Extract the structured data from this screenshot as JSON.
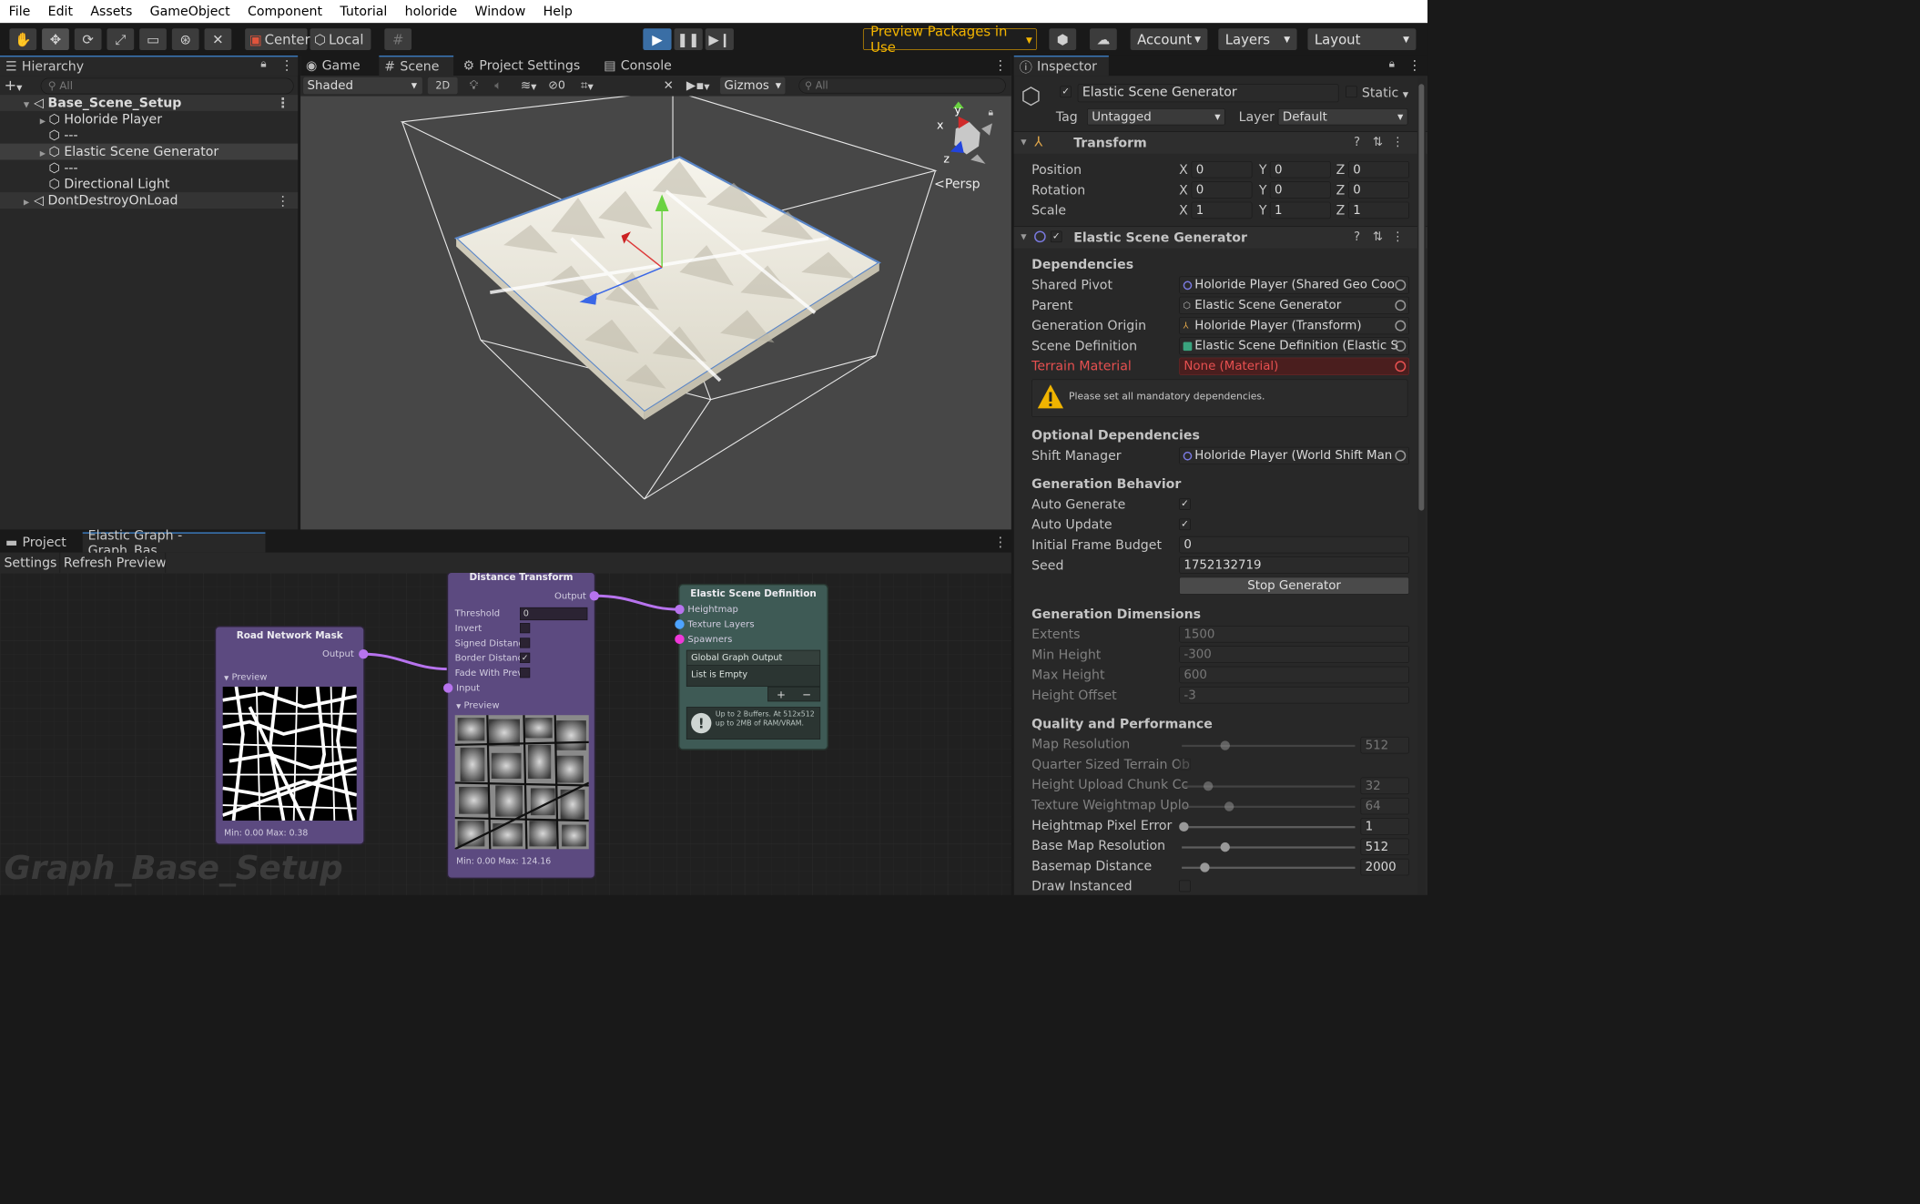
{
  "menu": [
    "File",
    "Edit",
    "Assets",
    "GameObject",
    "Component",
    "Tutorial",
    "holoride",
    "Window",
    "Help"
  ],
  "toolbar": {
    "pivot_mode": "Center",
    "pivot_space": "Local",
    "preview_packages": "Preview Packages in Use",
    "account": "Account",
    "layers": "Layers",
    "layout": "Layout"
  },
  "hierarchy": {
    "tab": "Hierarchy",
    "search_placeholder": "All",
    "items": [
      {
        "label": "Base_Scene_Setup",
        "kind": "scene"
      },
      {
        "label": "Holoride Player",
        "kind": "object"
      },
      {
        "label": "---",
        "kind": "object"
      },
      {
        "label": "Elastic Scene Generator",
        "kind": "object"
      },
      {
        "label": "---",
        "kind": "object"
      },
      {
        "label": "Directional Light",
        "kind": "object"
      },
      {
        "label": "DontDestroyOnLoad",
        "kind": "scene"
      }
    ]
  },
  "scene_view": {
    "tabs": [
      "Game",
      "Scene",
      "Project Settings",
      "Console"
    ],
    "shading": "Shaded",
    "mode_2d": "2D",
    "hidden_count": "0",
    "gizmos": "Gizmos",
    "search_placeholder": "All",
    "persp_label": "Persp",
    "axis_labels": {
      "x": "x",
      "y": "y",
      "z": "z"
    }
  },
  "inspector": {
    "tab": "Inspector",
    "object_name": "Elastic Scene Generator",
    "static_label": "Static",
    "tag_label": "Tag",
    "tag_value": "Untagged",
    "layer_label": "Layer",
    "layer_value": "Default",
    "transform": {
      "title": "Transform",
      "rows": [
        {
          "label": "Position",
          "x": "0",
          "y": "0",
          "z": "0"
        },
        {
          "label": "Rotation",
          "x": "0",
          "y": "0",
          "z": "0"
        },
        {
          "label": "Scale",
          "x": "1",
          "y": "1",
          "z": "1"
        }
      ],
      "axis": [
        "X",
        "Y",
        "Z"
      ]
    },
    "component": {
      "title": "Elastic Scene Generator",
      "dependencies_header": "Dependencies",
      "dependencies": [
        {
          "label": "Shared Pivot",
          "value": "Holoride Player (Shared Geo Coo"
        },
        {
          "label": "Parent",
          "value": "Elastic Scene Generator"
        },
        {
          "label": "Generation Origin",
          "value": "Holoride Player (Transform)"
        },
        {
          "label": "Scene Definition",
          "value": "Elastic Scene Definition (Elastic S"
        },
        {
          "label": "Terrain Material",
          "value": "None (Material)"
        }
      ],
      "warning": "Please set all mandatory dependencies.",
      "optional_header": "Optional Dependencies",
      "shift_manager_label": "Shift Manager",
      "shift_manager_value": "Holoride Player (World Shift Man",
      "behavior_header": "Generation Behavior",
      "auto_generate": "Auto Generate",
      "auto_update": "Auto Update",
      "initial_frame_budget_label": "Initial Frame Budget",
      "initial_frame_budget": "0",
      "seed_label": "Seed",
      "seed": "1752132719",
      "stop_button": "Stop Generator",
      "dimensions_header": "Generation Dimensions",
      "dimensions": [
        {
          "label": "Extents",
          "value": "1500"
        },
        {
          "label": "Min Height",
          "value": "-300"
        },
        {
          "label": "Max Height",
          "value": "600"
        },
        {
          "label": "Height Offset",
          "value": "-3"
        }
      ],
      "quality_header": "Quality and Performance",
      "quality": [
        {
          "label": "Map Resolution",
          "value": "512",
          "level": 0.24,
          "dim": true
        },
        {
          "label": "Quarter Sized Terrain Ob",
          "checkbox": true,
          "dim": true
        },
        {
          "label": "Height Upload Chunk Cc",
          "value": "32",
          "level": 0.14,
          "dim": true
        },
        {
          "label": "Texture Weightmap Uplo",
          "value": "64",
          "level": 0.26,
          "dim": true
        },
        {
          "label": "Heightmap Pixel Error",
          "value": "1",
          "level": 0.0,
          "dim": false
        },
        {
          "label": "Base Map Resolution",
          "value": "512",
          "level": 0.24,
          "dim": false
        },
        {
          "label": "Basemap Distance",
          "value": "2000",
          "level": 0.12,
          "dim": false
        },
        {
          "label": "Draw Instanced",
          "checkbox": true,
          "dim": false
        }
      ]
    }
  },
  "graph": {
    "tabs": [
      "Project",
      "Elastic Graph - Graph_Bas..."
    ],
    "toolbar": [
      "Settings",
      "Refresh Preview"
    ],
    "watermark": "Graph_Base_Setup",
    "nodes": {
      "road": {
        "title": "Road Network Mask",
        "output": "Output",
        "preview": "Preview",
        "stats": "Min: 0.00 Max: 0.38"
      },
      "distance": {
        "title": "Distance Transform",
        "output": "Output",
        "threshold_label": "Threshold",
        "threshold_value": "0",
        "invert": "Invert",
        "signed": "Signed Distanc",
        "border": "Border Distanc",
        "fade": "Fade With Prev",
        "input": "Input",
        "preview": "Preview",
        "stats": "Min: 0.00 Max: 124.16"
      },
      "definition": {
        "title": "Elastic Scene Definition",
        "heightmap": "Heightmap",
        "texture_layers": "Texture Layers",
        "spawners": "Spawners",
        "list_title": "Global Graph Output",
        "list_empty": "List is Empty",
        "note": "Up to 2 Buffers. At 512x512 up to 2MB of RAM/VRAM."
      }
    }
  },
  "colors": {
    "accent": "#3a79bb",
    "warning": "#f0b400",
    "error_text": "#e65050",
    "node_purple": "#5c4a80",
    "node_teal": "#3e5a55",
    "port_purple": "#b773ee"
  }
}
